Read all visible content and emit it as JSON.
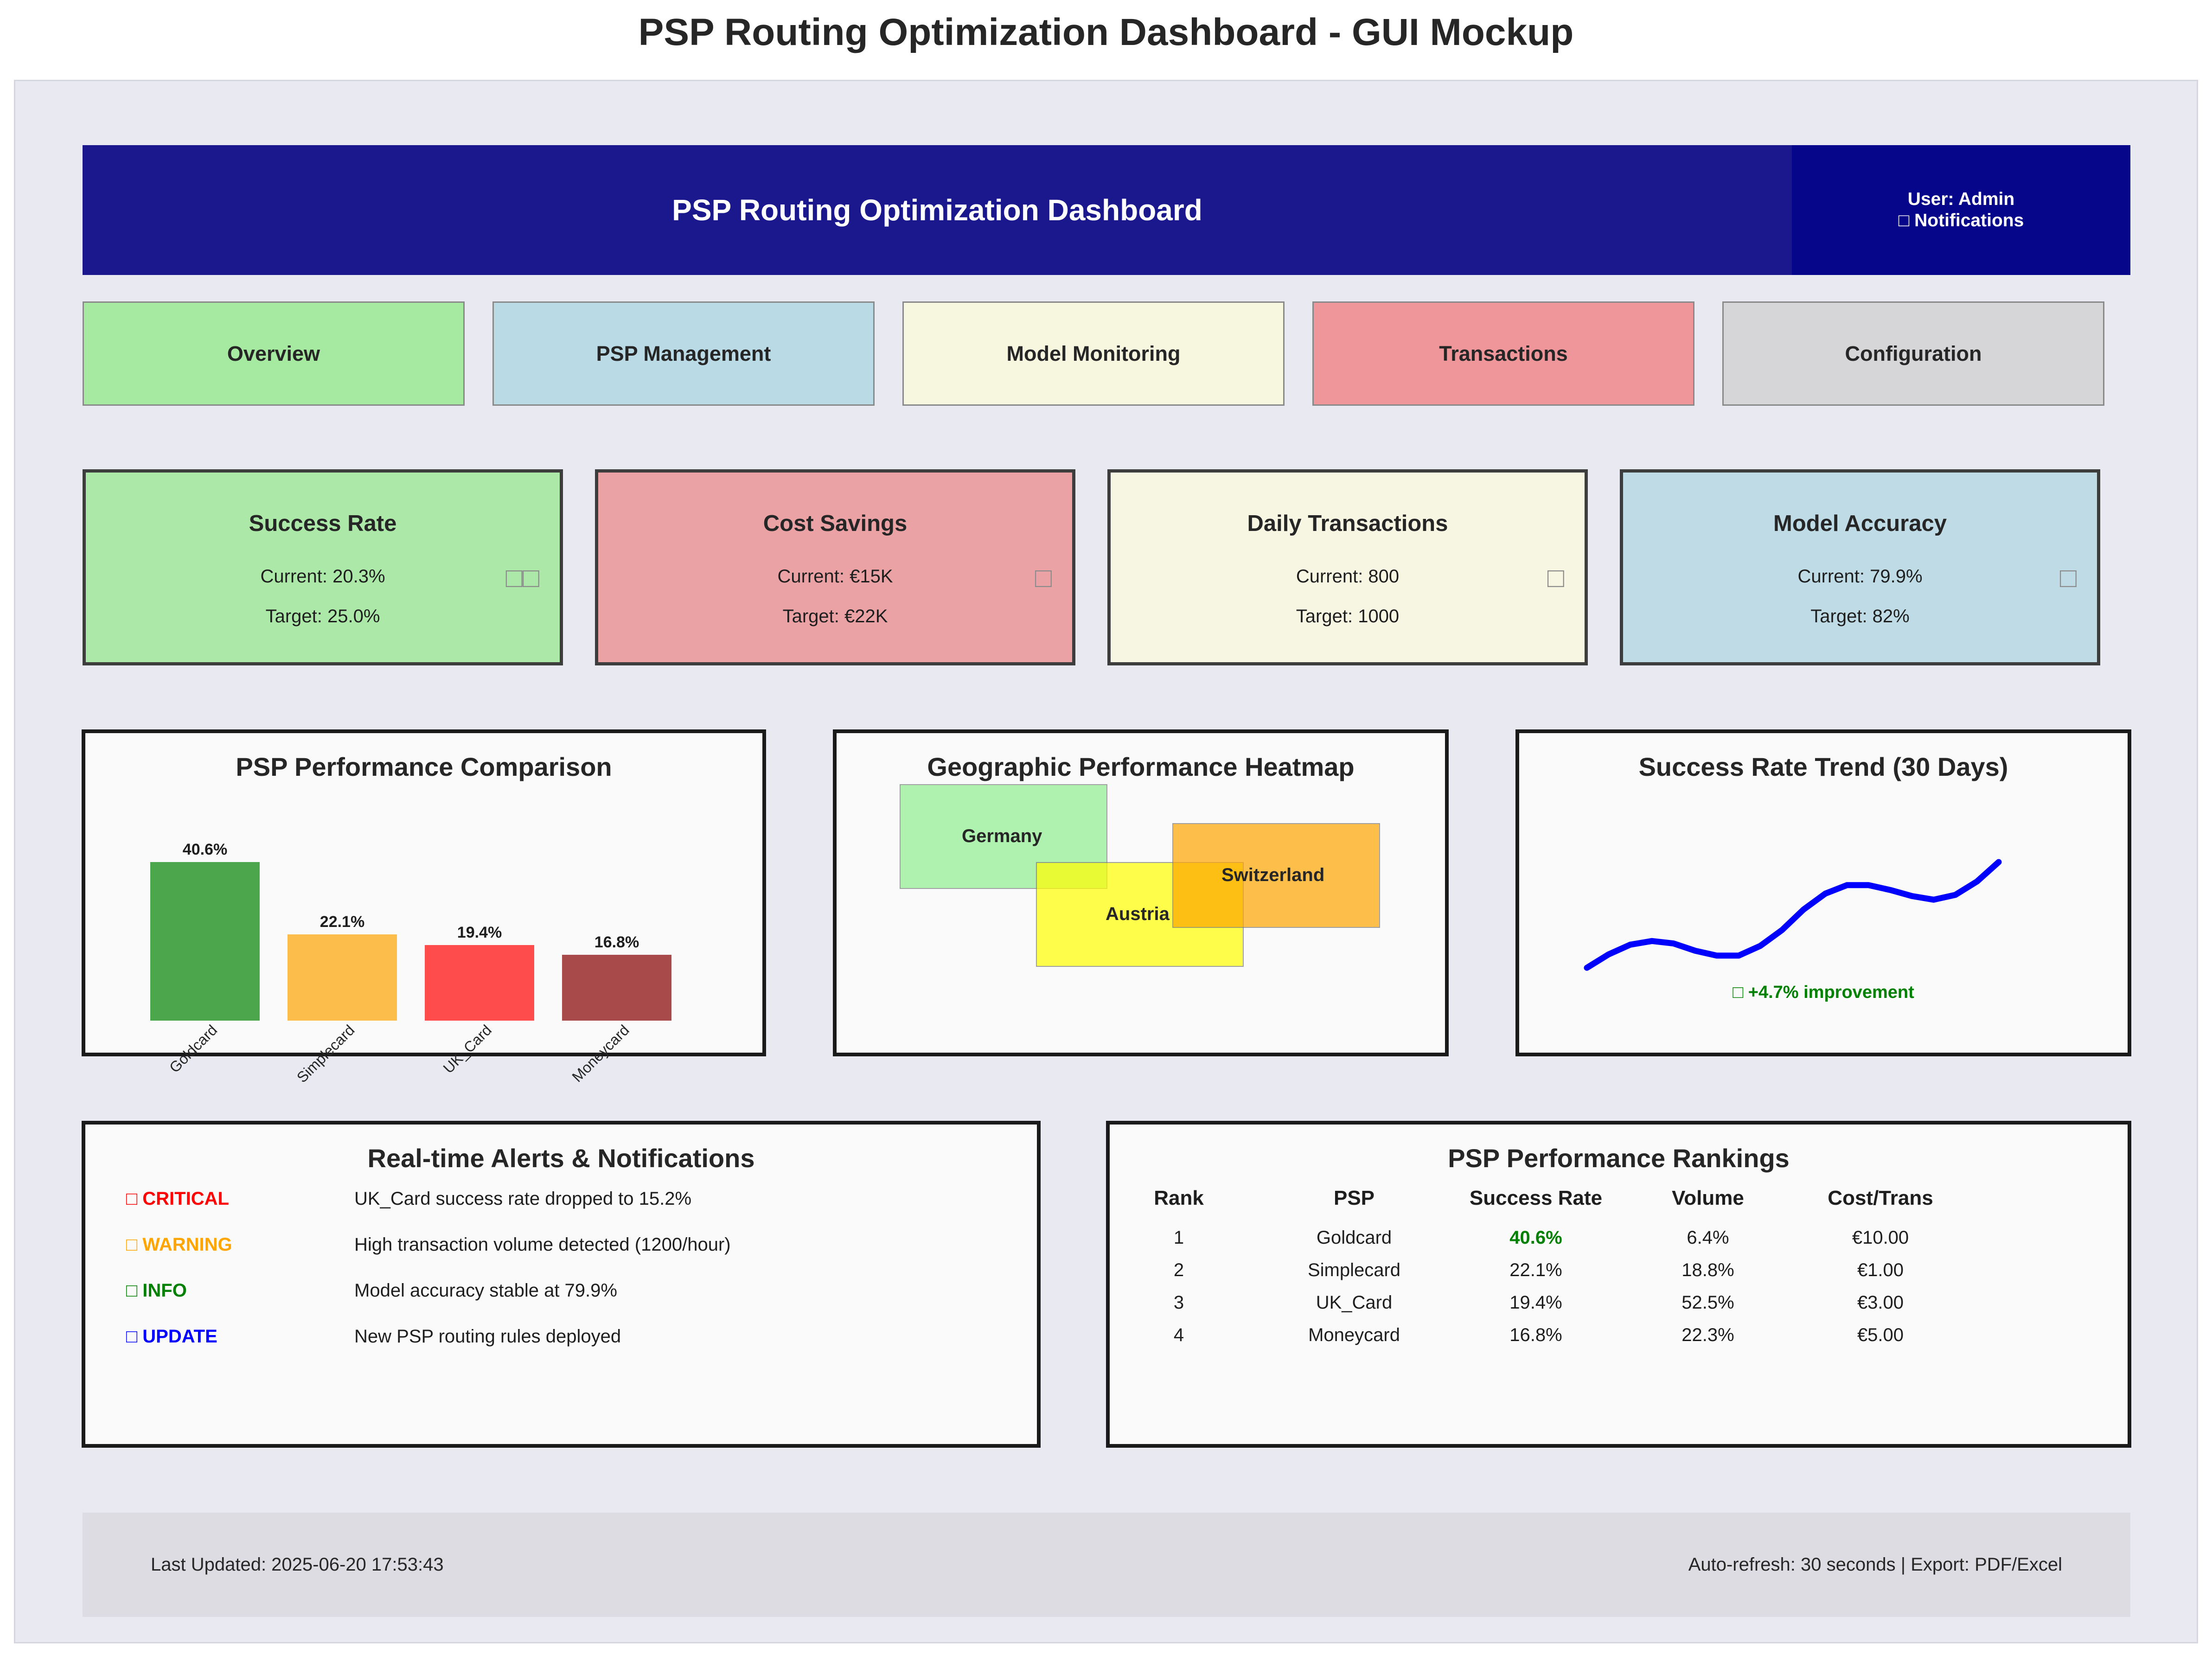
{
  "page_title": "PSP Routing Optimization Dashboard - GUI Mockup",
  "header": {
    "title": "PSP Routing Optimization Dashboard",
    "user_label": "User: Admin",
    "notifications_label": "□ Notifications"
  },
  "tabs": [
    {
      "label": "Overview",
      "color": "#a6eaa2"
    },
    {
      "label": "PSP Management",
      "color": "#badbe6"
    },
    {
      "label": "Model Monitoring",
      "color": "#f7f7df"
    },
    {
      "label": "Transactions",
      "color": "#ee9699"
    },
    {
      "label": "Configuration",
      "color": "#d6d6d8"
    }
  ],
  "kpis": [
    {
      "title": "Success Rate",
      "current": "Current: 20.3%",
      "target": "Target: 25.0%",
      "icon": "□□",
      "icon_name": "trend-icon",
      "color": "#ace9a9"
    },
    {
      "title": "Cost Savings",
      "current": "Current: €15K",
      "target": "Target: €22K",
      "icon": "□",
      "icon_name": "money-icon",
      "color": "#eba2a5"
    },
    {
      "title": "Daily Transactions",
      "current": "Current: 800",
      "target": "Target: 1000",
      "icon": "□",
      "icon_name": "transactions-icon",
      "color": "#f7f6e2"
    },
    {
      "title": "Model Accuracy",
      "current": "Current: 79.9%",
      "target": "Target: 82%",
      "icon": "□",
      "icon_name": "target-icon",
      "color": "#bfdbe6"
    }
  ],
  "performance_chart": {
    "title": "PSP Performance Comparison"
  },
  "chart_data": {
    "type": "bar",
    "title": "PSP Performance Comparison",
    "categories": [
      "Goldcard",
      "Simplecard",
      "UK_Card",
      "Moneycard"
    ],
    "values": [
      40.6,
      22.1,
      19.4,
      16.8
    ],
    "value_labels": [
      "40.6%",
      "22.1%",
      "19.4%",
      "16.8%"
    ],
    "colors": [
      "#4ca64c",
      "#fdbd4a",
      "#fe4c4c",
      "#a94a4a"
    ],
    "xlabel": "",
    "ylabel": "",
    "ylim": [
      0,
      45
    ]
  },
  "heatmap": {
    "title": "Geographic Performance Heatmap",
    "regions": [
      {
        "name": "Germany",
        "color": "#90ee90"
      },
      {
        "name": "Austria",
        "color": "#ffff00"
      },
      {
        "name": "Switzerland",
        "color": "#ffa500"
      }
    ]
  },
  "trend": {
    "title": "Success Rate Trend (30 Days)",
    "improvement": "□ +4.7% improvement",
    "line_color": "#0000ff",
    "values": [
      14.8,
      15.9,
      16.7,
      17.0,
      16.8,
      16.2,
      15.8,
      15.8,
      16.6,
      17.9,
      19.6,
      20.9,
      21.6,
      21.6,
      21.2,
      20.7,
      20.4,
      20.8,
      21.9,
      23.5
    ]
  },
  "alerts": {
    "title": "Real-time Alerts & Notifications",
    "items": [
      {
        "level": "□ CRITICAL",
        "message": "UK_Card success rate dropped to 15.2%",
        "color": "#ff0000"
      },
      {
        "level": "□ WARNING",
        "message": "High transaction volume detected (1200/hour)",
        "color": "#ffa500"
      },
      {
        "level": "□ INFO",
        "message": "Model accuracy stable at 79.9%",
        "color": "#008000"
      },
      {
        "level": "□ UPDATE",
        "message": "New PSP routing rules deployed",
        "color": "#0000ff"
      }
    ]
  },
  "rankings": {
    "title": "PSP Performance Rankings",
    "columns": [
      "Rank",
      "PSP",
      "Success Rate",
      "Volume",
      "Cost/Trans"
    ],
    "highlight_color": "#008000",
    "rows": [
      [
        "1",
        "Goldcard",
        "40.6%",
        "6.4%",
        "€10.00"
      ],
      [
        "2",
        "Simplecard",
        "22.1%",
        "18.8%",
        "€1.00"
      ],
      [
        "3",
        "UK_Card",
        "19.4%",
        "52.5%",
        "€3.00"
      ],
      [
        "4",
        "Moneycard",
        "16.8%",
        "22.3%",
        "€5.00"
      ]
    ]
  },
  "footer": {
    "last_updated": "Last Updated: 2025-06-20 17:53:43",
    "auto_refresh": "Auto-refresh: 30 seconds | Export: PDF/Excel"
  }
}
